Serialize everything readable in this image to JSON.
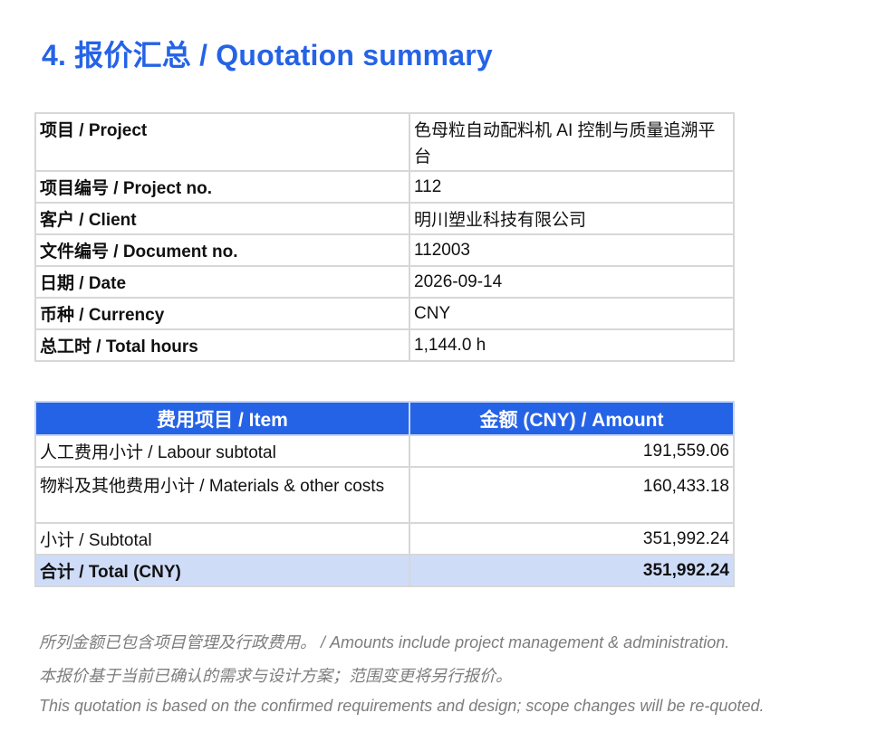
{
  "heading": "4. 报价汇总 / Quotation summary",
  "info_rows": [
    {
      "label": "项目 / Project",
      "value": "色母粒自动配料机 AI 控制与质量追溯平台"
    },
    {
      "label": "项目编号 / Project no.",
      "value": "112"
    },
    {
      "label": "客户 / Client",
      "value": "明川塑业科技有限公司"
    },
    {
      "label": "文件编号 / Document no.",
      "value": "112003"
    },
    {
      "label": "日期 / Date",
      "value": "2026-09-14"
    },
    {
      "label": "币种 / Currency",
      "value": "CNY"
    },
    {
      "label": "总工时 / Total hours",
      "value": "1,144.0 h"
    }
  ],
  "cost_table": {
    "headers": [
      "费用项目 / Item",
      "金额 (CNY) / Amount"
    ],
    "rows": [
      {
        "item": "人工费用小计 / Labour subtotal",
        "amount": "191,559.06"
      },
      {
        "item": "物料及其他费用小计 / Materials & other costs",
        "amount": "160,433.18"
      },
      {
        "item": "小计 / Subtotal",
        "amount": "351,992.24"
      },
      {
        "item": "合计 / Total (CNY)",
        "amount": "351,992.24"
      }
    ]
  },
  "notes": [
    "所列金额已包含项目管理及行政费用。 / Amounts include project management & administration.",
    "本报价基于当前已确认的需求与设计方案；范围变更将另行报价。",
    "This quotation is based on the confirmed requirements and design; scope changes will be re-quoted."
  ],
  "colors": {
    "accent": "#2563e6",
    "total_row_bg": "#cfdcf8",
    "border": "#d7d7d7",
    "note_text": "#7d7d7d"
  }
}
